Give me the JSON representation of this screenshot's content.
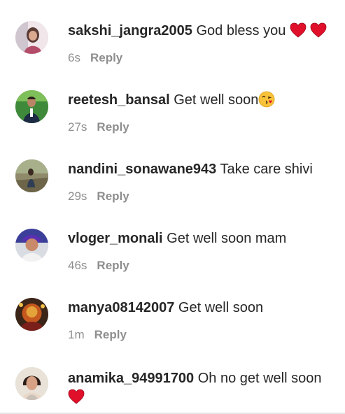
{
  "reply_label": "Reply",
  "comments": [
    {
      "username": "sakshi_jangra2005",
      "text": "God bless you",
      "time": "6s",
      "emojis": [
        "red-heart",
        "red-heart"
      ]
    },
    {
      "username": "reetesh_bansal",
      "text": "Get well soon",
      "time": "27s",
      "emojis": [
        "face-blowing-kiss"
      ]
    },
    {
      "username": "nandini_sonawane943",
      "text": "Take care shivi",
      "time": "29s",
      "emojis": []
    },
    {
      "username": "vloger_monali",
      "text": "Get well soon mam",
      "time": "46s",
      "emojis": []
    },
    {
      "username": "manya08142007",
      "text": "Get well soon",
      "time": "1m",
      "emojis": []
    },
    {
      "username": "anamika_94991700",
      "text": "Oh no get well soon",
      "time": "",
      "emojis": [
        "red-heart"
      ]
    }
  ],
  "colors": {
    "text": "#262626",
    "meta": "#8e8e8e",
    "heart": "#e0102a",
    "background": "#ffffff"
  }
}
